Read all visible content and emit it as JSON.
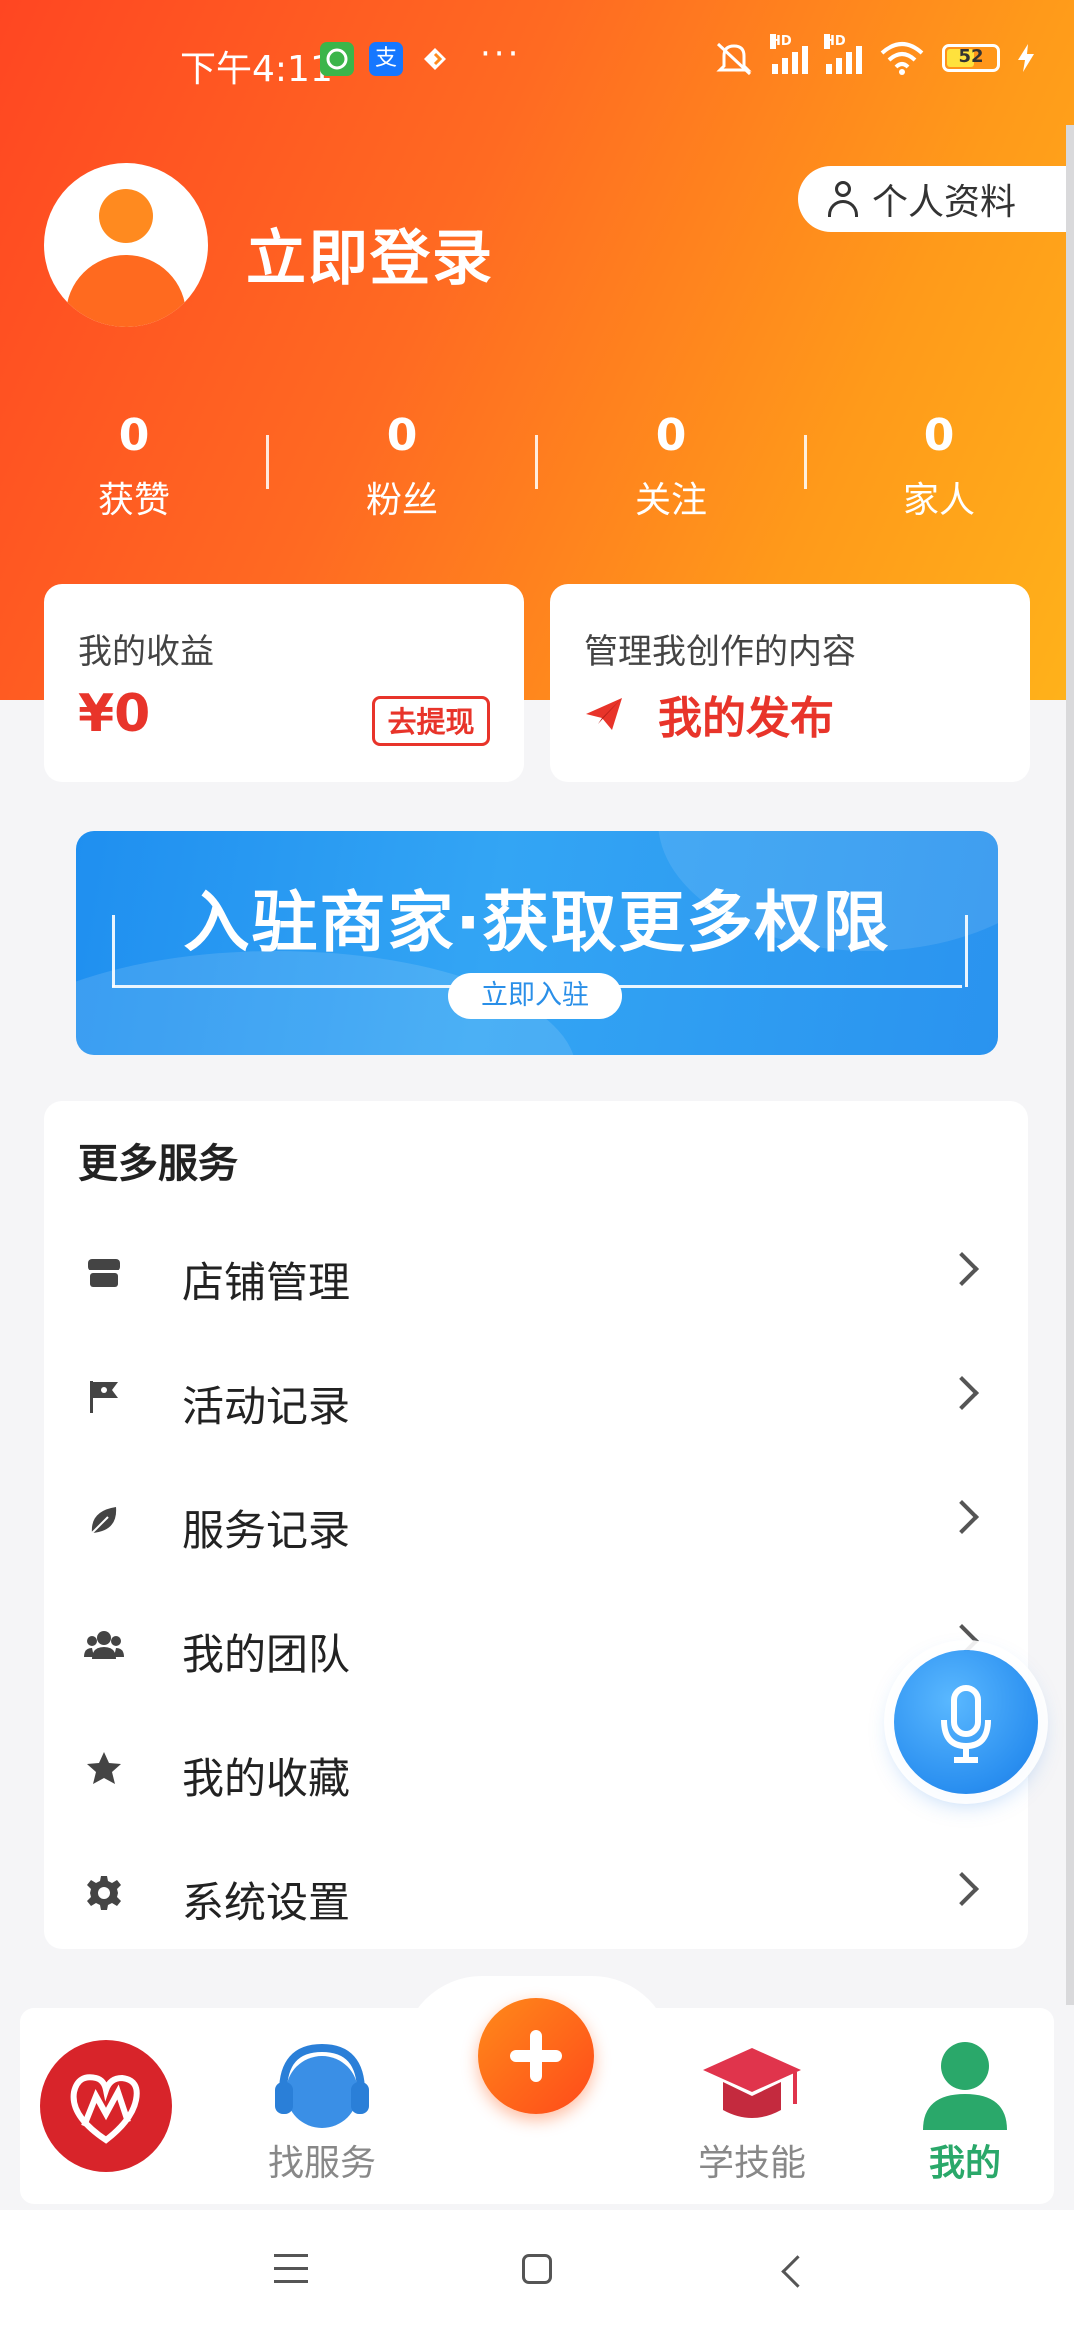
{
  "status_bar": {
    "time": "下午4:11",
    "dots": "···",
    "battery": "52",
    "hd1": "HD",
    "hd2": "HD",
    "alipay_glyph": "支"
  },
  "profile": {
    "login_label": "立即登录",
    "profile_button": "个人资料"
  },
  "stats": [
    {
      "value": "0",
      "label": "获赞"
    },
    {
      "value": "0",
      "label": "粉丝"
    },
    {
      "value": "0",
      "label": "关注"
    },
    {
      "value": "0",
      "label": "家人"
    }
  ],
  "earnings": {
    "title": "我的收益",
    "amount": "¥0",
    "withdraw": "去提现"
  },
  "content": {
    "title": "管理我创作的内容",
    "publish": "我的发布"
  },
  "banner": {
    "title": "入驻商家·获取更多权限",
    "cta": "立即入驻"
  },
  "services": {
    "header": "更多服务",
    "items": [
      {
        "label": "店铺管理",
        "icon": "store-icon"
      },
      {
        "label": "活动记录",
        "icon": "flag-icon"
      },
      {
        "label": "服务记录",
        "icon": "leaf-icon"
      },
      {
        "label": "我的团队",
        "icon": "team-icon"
      },
      {
        "label": "我的收藏",
        "icon": "star-icon"
      },
      {
        "label": "系统设置",
        "icon": "gear-icon"
      }
    ]
  },
  "bottom_nav": {
    "find_service": "找服务",
    "learn_skills": "学技能",
    "mine": "我的"
  },
  "colors": {
    "accent_red": "#e8342a",
    "active_green": "#2aa86a",
    "hero_start": "#ff4622",
    "hero_end": "#ffb21a"
  }
}
